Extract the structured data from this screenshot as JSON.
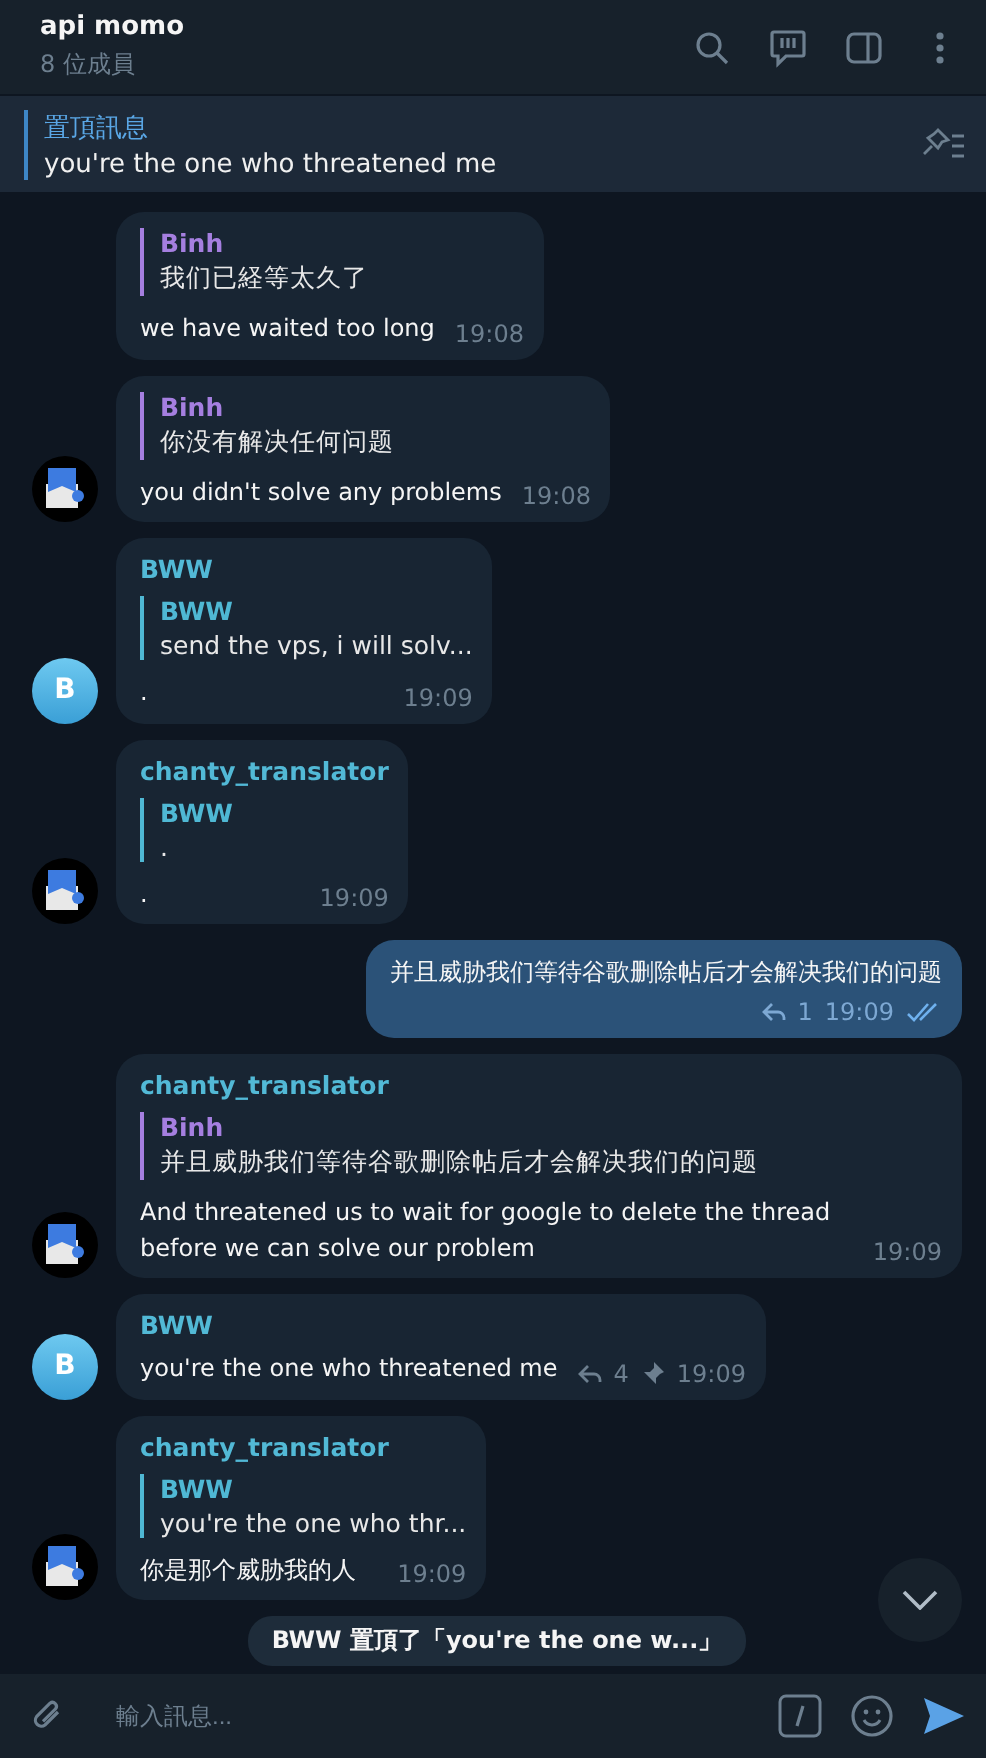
{
  "header": {
    "title": "api momo",
    "subtitle": "8 位成員"
  },
  "pinned": {
    "label": "置頂訊息",
    "text": "you're the one who threatened me"
  },
  "messages": [
    {
      "kind": "incoming",
      "quote": {
        "name": "Binh",
        "text": "我们已経等太久了",
        "color": "#a57fe0"
      },
      "text": "we have waited too long",
      "time": "19:08"
    },
    {
      "kind": "incoming",
      "avatar": {
        "kind": "translator"
      },
      "quote": {
        "name": "Binh",
        "text": "你没有解决任何问题",
        "color": "#a57fe0"
      },
      "text": "you didn't solve any problems",
      "time": "19:08"
    },
    {
      "kind": "incoming",
      "avatar": {
        "kind": "letter",
        "letter": "B"
      },
      "sender": "BWW",
      "quote": {
        "name": "BWW",
        "text": "send the vps, i will solv...",
        "color": "#4fb8d4"
      },
      "text": ".",
      "time": "19:09"
    },
    {
      "kind": "incoming",
      "avatar": {
        "kind": "translator"
      },
      "sender": "chanty_translator",
      "quote": {
        "name": "BWW",
        "text": ".",
        "color": "#4fb8d4"
      },
      "text": ".",
      "time": "19:09"
    },
    {
      "kind": "outgoing",
      "text": "并且威胁我们等待谷歌删除帖后才会解决我们的问题",
      "replies": "1",
      "time": "19:09",
      "read": true
    },
    {
      "kind": "incoming",
      "avatar": {
        "kind": "translator"
      },
      "sender": "chanty_translator",
      "quote": {
        "name": "Binh",
        "text": "并且威胁我们等待谷歌删除帖后才会解决我们的问题",
        "color": "#a57fe0"
      },
      "text": "And threatened us to wait for google to delete the thread before we can solve our problem",
      "time": "19:09"
    },
    {
      "kind": "incoming",
      "avatar": {
        "kind": "letter",
        "letter": "B"
      },
      "sender": "BWW",
      "text": "you're the one who threatened me",
      "replies": "4",
      "pinned": true,
      "time": "19:09"
    },
    {
      "kind": "incoming",
      "avatar": {
        "kind": "translator"
      },
      "sender": "chanty_translator",
      "quote": {
        "name": "BWW",
        "text": "you're the one who thr...",
        "color": "#4fb8d4"
      },
      "text": "你是那个威胁我的人",
      "time": "19:09"
    },
    {
      "kind": "service",
      "text": "BWW 置頂了「you're the one w...」"
    }
  ],
  "composer": {
    "placeholder": "輸入訊息..."
  }
}
